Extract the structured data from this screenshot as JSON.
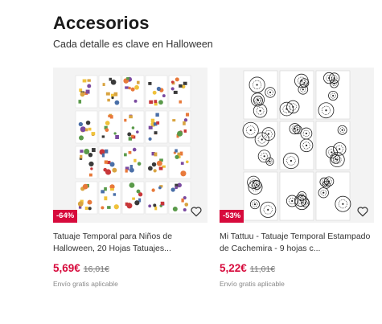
{
  "section": {
    "title": "Accesorios",
    "subtitle": "Cada detalle es clave en Halloween"
  },
  "products": [
    {
      "title": "Tatuaje Temporal para Niños de Halloween, 20 Hojas Tatuajes...",
      "discount": "-64%",
      "price": "5,69€",
      "old_price": "16,01€",
      "shipping": "Envío gratis aplicable",
      "favorite_icon": "heart-icon"
    },
    {
      "title": "Mi Tattuu - Tatuaje Temporal Estampado de Cachemira - 9 hojas c...",
      "discount": "-53%",
      "price": "5,22€",
      "old_price": "11,01€",
      "shipping": "Envío gratis aplicable",
      "favorite_icon": "heart-icon"
    }
  ],
  "colors": {
    "accent": "#d70a3c",
    "text": "#333333",
    "muted": "#888888"
  }
}
